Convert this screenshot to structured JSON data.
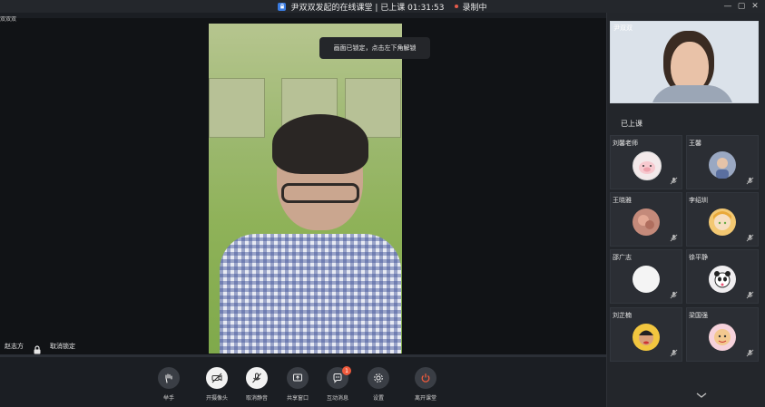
{
  "window": {
    "title": "尹双双发起的在线课堂 | 已上课 01:31:53",
    "recording": "录制中",
    "controls": [
      "minimize-icon",
      "maximize-icon",
      "close-icon"
    ]
  },
  "stage": {
    "corner_label": "双双双",
    "toast": "画面已锁定，点击左下角解锁",
    "presenter": "赵志方",
    "unlock_label": "取消锁定"
  },
  "teacher_video": {
    "name": "尹双双"
  },
  "roster": {
    "title": "已上课",
    "members": [
      {
        "name": "刘馨老师",
        "avatar": "pig-avatar"
      },
      {
        "name": "王馨",
        "avatar": "illustration-avatar"
      },
      {
        "name": "王晓雅",
        "avatar": "photo-avatar"
      },
      {
        "name": "李绍圳",
        "avatar": "anime-avatar"
      },
      {
        "name": "邵广志",
        "avatar": "blank-avatar"
      },
      {
        "name": "徐平静",
        "avatar": "panda-avatar"
      },
      {
        "name": "刘芷楠",
        "avatar": "child-avatar"
      },
      {
        "name": "梁国强",
        "avatar": "cartoon-avatar"
      }
    ]
  },
  "toolbar": {
    "raise_hand": "举手",
    "camera": "开摄像头",
    "mute": "取消静音",
    "share": "共享窗口",
    "messages": "互动消息",
    "messages_badge": "1",
    "settings": "设置",
    "leave": "离开课堂"
  },
  "colors": {
    "accent": "#3a7be0",
    "record": "#e55b4b",
    "leave": "#ef5a3c"
  }
}
